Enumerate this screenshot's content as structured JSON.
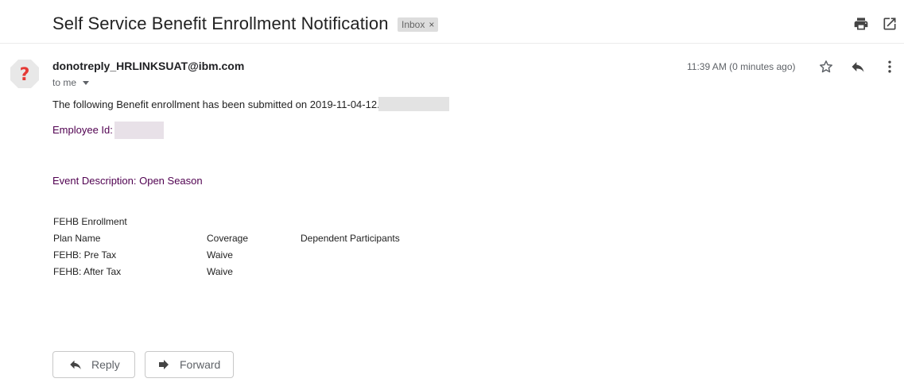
{
  "email": {
    "subject": "Self Service Benefit Enrollment Notification",
    "label": "Inbox",
    "label_remove": "×",
    "sender": "donotreply_HRLINKSUAT@ibm.com",
    "recipient": "to me",
    "timestamp": "11:39 AM (0 minutes ago)"
  },
  "body": {
    "submitted_line": "The following Benefit enrollment has been submitted on 2019-11-04-12.",
    "employee_id_label": "Employee Id:",
    "event_description": "Event Description: Open Season",
    "section_title": "FEHB Enrollment",
    "table": {
      "headers": [
        "Plan Name",
        "Coverage",
        "Dependent Participants"
      ],
      "rows": [
        [
          "FEHB: Pre Tax",
          "Waive",
          ""
        ],
        [
          "FEHB: After Tax",
          "Waive",
          ""
        ]
      ]
    }
  },
  "actions": {
    "reply_label": "Reply",
    "forward_label": "Forward"
  },
  "icons": {
    "print": "print-icon",
    "popout": "open-in-new-window-icon",
    "star": "star-icon",
    "reply": "reply-icon",
    "more": "more-vertical-icon",
    "avatar": "unknown-sender-avatar"
  },
  "colors": {
    "employee_text": "#500050",
    "label_chip": "#dddddd",
    "avatar_mark": "#e53935"
  }
}
